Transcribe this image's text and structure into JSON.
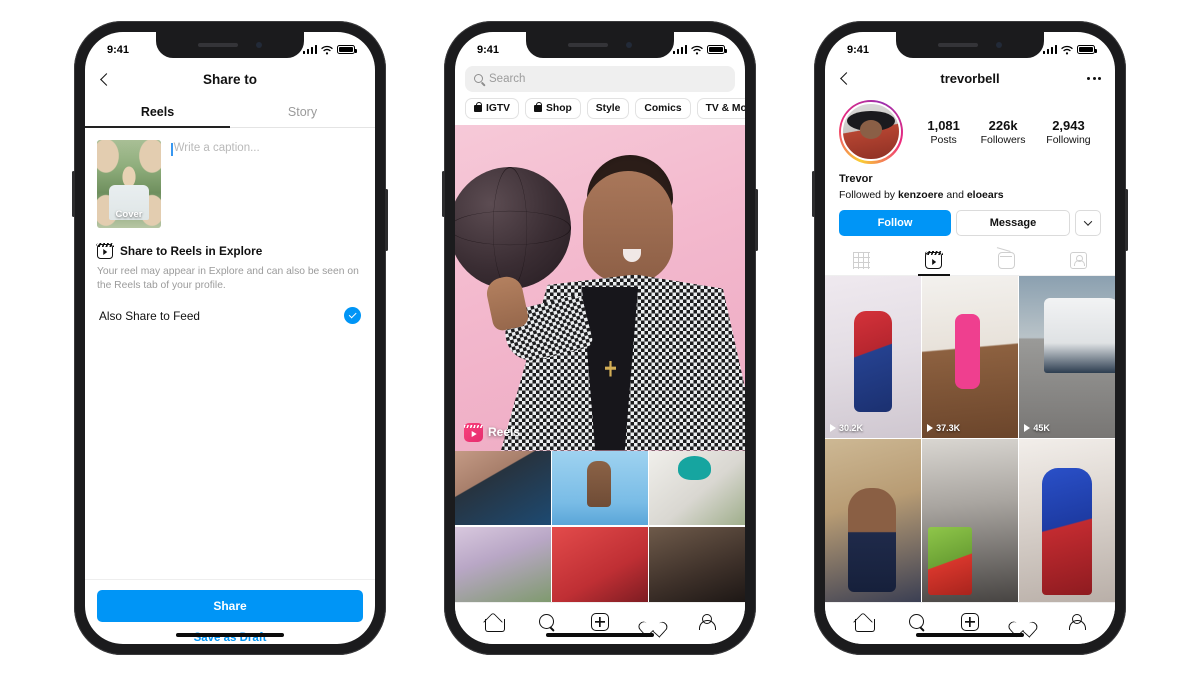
{
  "status_bar": {
    "time": "9:41",
    "signal_icon": "cellular-bars-icon",
    "wifi_icon": "wifi-icon",
    "battery_icon": "battery-icon"
  },
  "phone1": {
    "back_icon": "back-chevron-icon",
    "title": "Share to",
    "tabs": [
      {
        "label": "Reels",
        "active": true
      },
      {
        "label": "Story",
        "active": false
      }
    ],
    "cover": {
      "label": "Cover"
    },
    "caption": {
      "placeholder": "Write a caption..."
    },
    "explore": {
      "icon": "reels-icon",
      "title": "Share to Reels in Explore",
      "description": "Your reel may appear in Explore and can also be seen on the Reels tab of your profile."
    },
    "also_share": {
      "label": "Also Share to Feed",
      "checked": true,
      "check_icon": "check-circle-icon"
    },
    "share_button": "Share",
    "draft_button": "Save as Draft",
    "accent_color": "#0095F6"
  },
  "phone2": {
    "search": {
      "placeholder": "Search",
      "icon": "search-icon"
    },
    "chips": [
      {
        "label": "IGTV",
        "icon": "igtv-bag-icon"
      },
      {
        "label": "Shop",
        "icon": "shopping-bag-icon"
      },
      {
        "label": "Style",
        "icon": ""
      },
      {
        "label": "Comics",
        "icon": ""
      },
      {
        "label": "TV & Movies",
        "icon": ""
      }
    ],
    "hero": {
      "badge_label": "Reels",
      "badge_icon": "reels-badge-icon",
      "background_color": "#F3B8CD"
    },
    "thumbnails": [
      {
        "name": "couple-signing-book"
      },
      {
        "name": "hand-with-beaded-jewelry"
      },
      {
        "name": "street-style-portrait"
      },
      {
        "name": "flowers-arrangement"
      },
      {
        "name": "red-fabric-portrait"
      },
      {
        "name": "dark-portrait"
      }
    ],
    "tabbar": [
      {
        "icon": "home-icon"
      },
      {
        "icon": "search-icon"
      },
      {
        "icon": "add-post-icon"
      },
      {
        "icon": "heart-icon"
      },
      {
        "icon": "profile-icon"
      }
    ]
  },
  "phone3": {
    "back_icon": "back-chevron-icon",
    "username": "trevorbell",
    "more_icon": "more-options-icon",
    "avatar": {
      "name": "avatar",
      "has_story_ring": true
    },
    "stats": [
      {
        "num": "1,081",
        "lbl": "Posts"
      },
      {
        "num": "226k",
        "lbl": "Followers"
      },
      {
        "num": "2,943",
        "lbl": "Following"
      }
    ],
    "bio": {
      "name": "Trevor",
      "followed_by_prefix": "Followed by ",
      "followed_by_1": "kenzoere",
      "followed_by_join": " and ",
      "followed_by_2": "eloears"
    },
    "follow_button": "Follow",
    "message_button": "Message",
    "dropdown_icon": "chevron-down-icon",
    "tabs": [
      {
        "icon": "grid-tab-icon",
        "active": false
      },
      {
        "icon": "reels-tab-icon",
        "active": true
      },
      {
        "icon": "igtv-tab-icon",
        "active": false
      },
      {
        "icon": "tagged-tab-icon",
        "active": false
      }
    ],
    "reels": [
      {
        "name": "spiderman-costume-dance",
        "views": "30.2K"
      },
      {
        "name": "group-dance-workout",
        "views": "37.3K"
      },
      {
        "name": "bus-fire-stunt",
        "views": "45K"
      },
      {
        "name": "talking-to-camera",
        "views": ""
      },
      {
        "name": "gym-box-jump",
        "views": ""
      },
      {
        "name": "superman-costume",
        "views": ""
      }
    ],
    "tabbar": [
      {
        "icon": "home-icon"
      },
      {
        "icon": "search-icon"
      },
      {
        "icon": "add-post-icon"
      },
      {
        "icon": "heart-icon"
      },
      {
        "icon": "profile-icon"
      }
    ]
  }
}
